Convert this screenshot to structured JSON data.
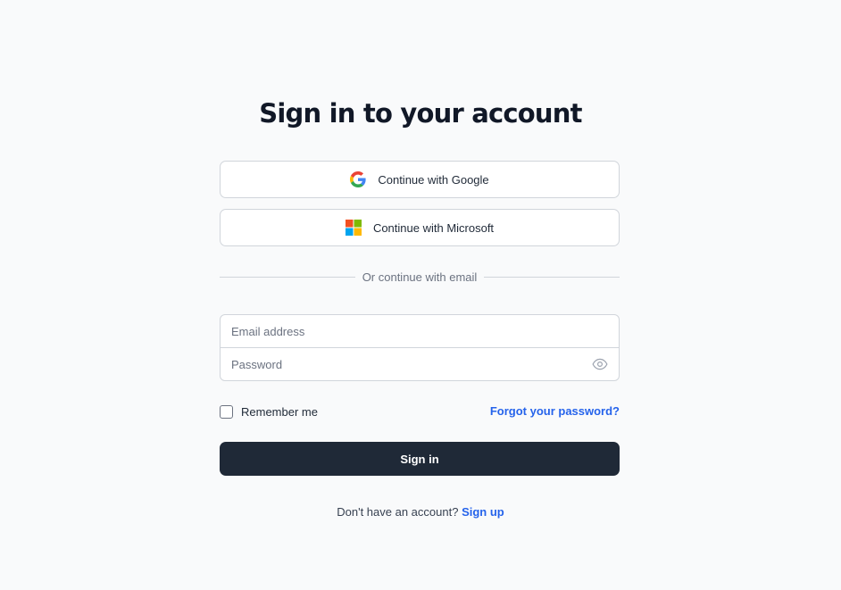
{
  "title": "Sign in to your account",
  "sso": {
    "google_label": "Continue with Google",
    "microsoft_label": "Continue with Microsoft"
  },
  "divider_text": "Or continue with email",
  "form": {
    "email_placeholder": "Email address",
    "password_placeholder": "Password",
    "remember_label": "Remember me",
    "forgot_label": "Forgot your password?",
    "submit_label": "Sign in"
  },
  "footer": {
    "prompt": "Don't have an account?",
    "signup_label": "Sign up"
  },
  "icons": {
    "google": "google-logo-icon",
    "microsoft": "microsoft-logo-icon",
    "password_toggle": "eye-icon"
  },
  "colors": {
    "background": "#f9fafb",
    "primary_button": "#1f2937",
    "link": "#2563eb",
    "border": "#d1d5db"
  }
}
